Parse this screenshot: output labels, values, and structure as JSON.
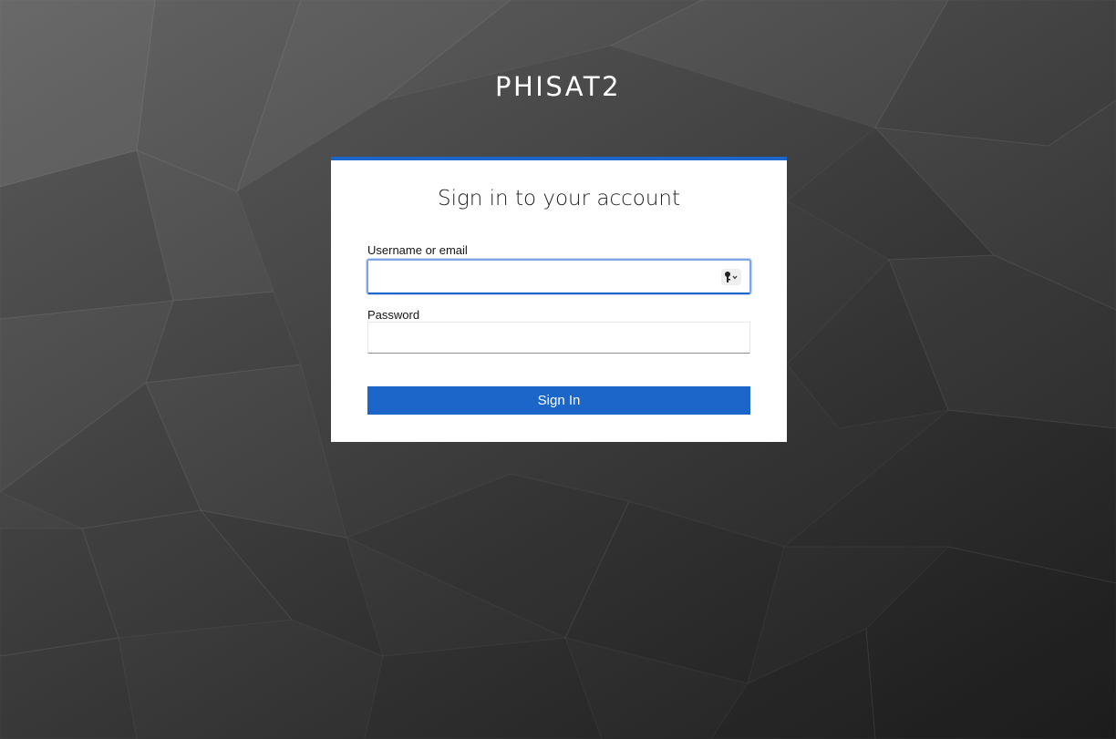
{
  "app": {
    "brand": "PHISAT2"
  },
  "login": {
    "title": "Sign in to your account",
    "username_label": "Username or email",
    "username_value": "",
    "password_label": "Password",
    "password_value": "",
    "submit_label": "Sign In"
  },
  "icons": {
    "autofill": "key-icon"
  },
  "colors": {
    "accent": "#1c65c9",
    "card_background": "#ffffff",
    "page_background": "#3c3c3c"
  }
}
